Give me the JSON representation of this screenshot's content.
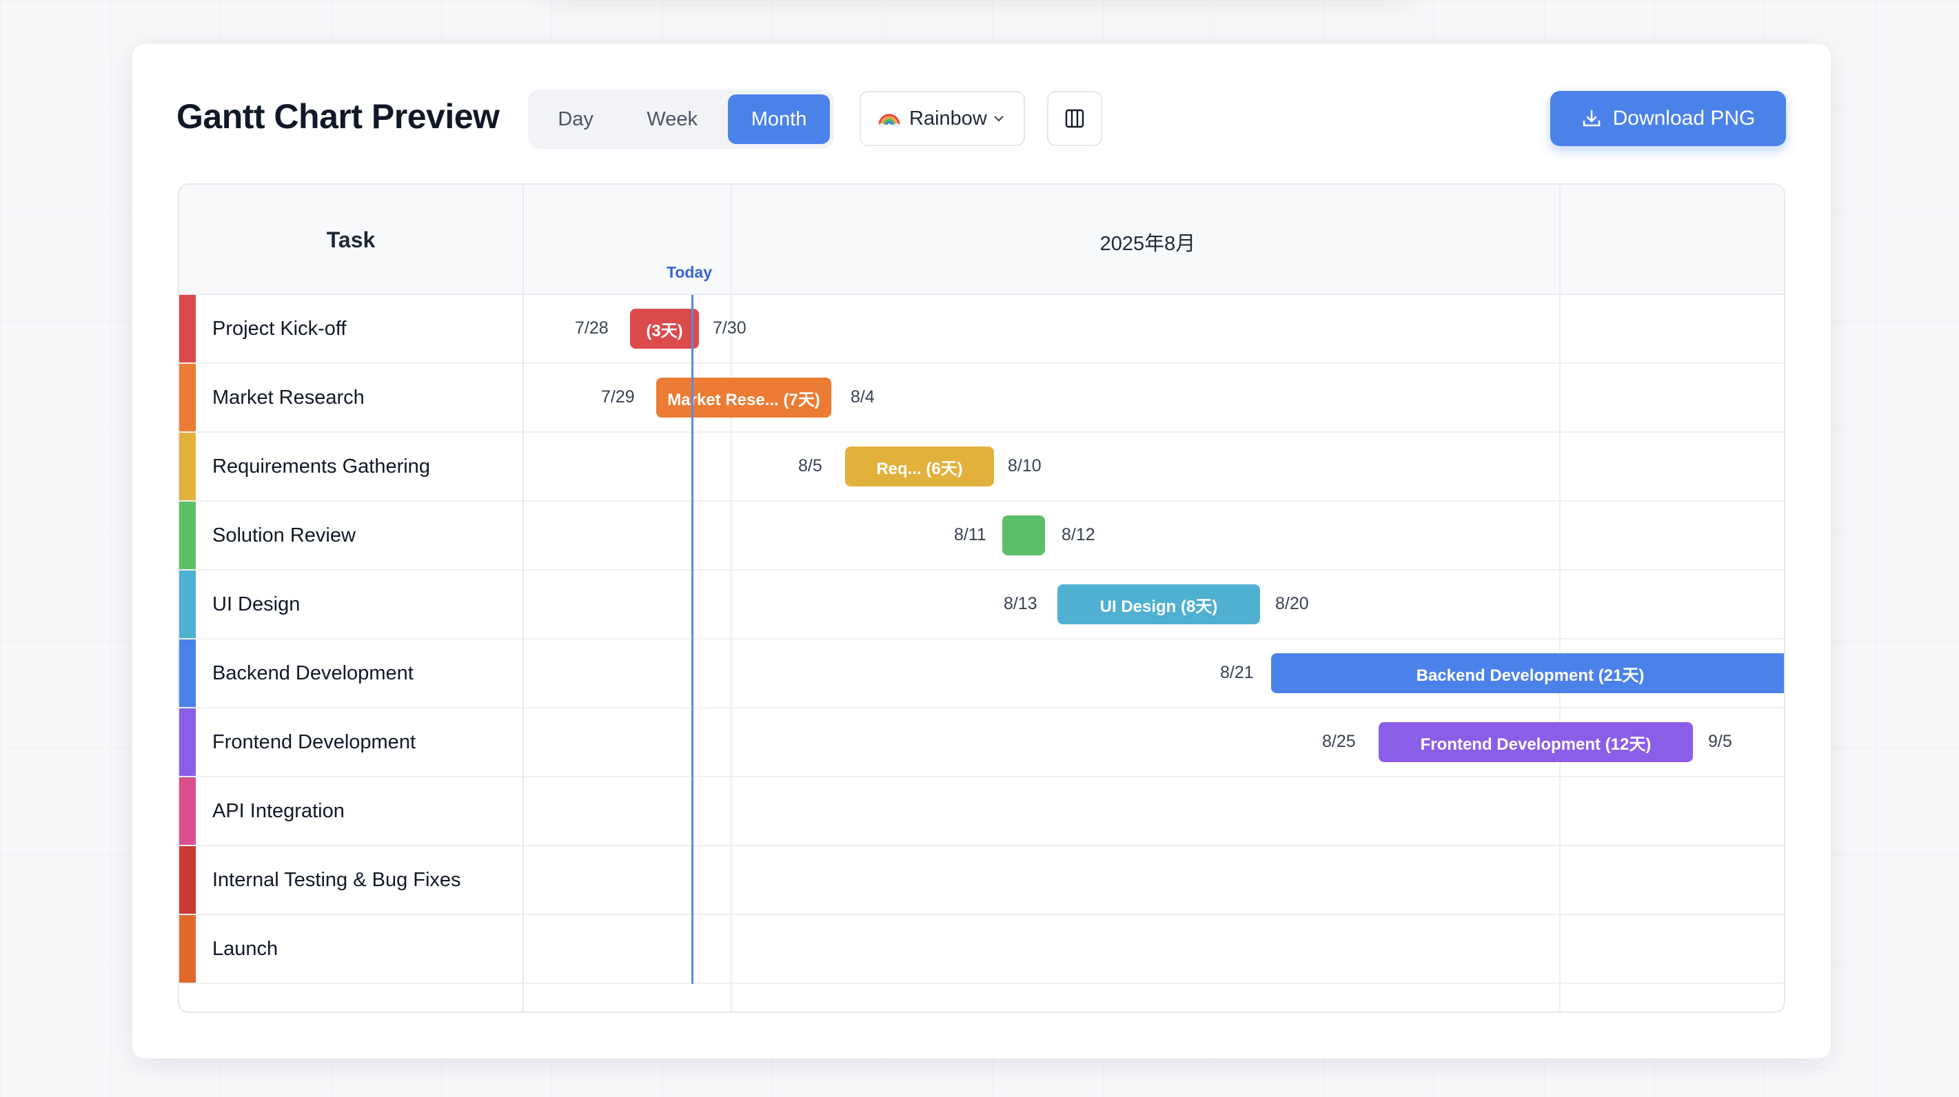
{
  "toolbar": {
    "title": "Gantt Chart Preview",
    "views": [
      {
        "label": "Day",
        "active": false
      },
      {
        "label": "Week",
        "active": false
      },
      {
        "label": "Month",
        "active": true
      }
    ],
    "theme": {
      "label": "Rainbow",
      "icon": "rainbow-icon"
    },
    "columns_icon": "columns-icon",
    "download_label": "Download PNG",
    "accent_color": "#4b82ea"
  },
  "gantt": {
    "task_header": "Task",
    "period_header": "2025年8月",
    "today_label": "Today",
    "tasks": [
      {
        "name": "Project Kick-off",
        "color": "#dc4b4b",
        "start_label": "7/28",
        "end_label": "7/30",
        "bar_text": "(3天)"
      },
      {
        "name": "Market Research",
        "color": "#ec7b34",
        "start_label": "7/29",
        "end_label": "8/4",
        "bar_text": "Market Rese... (7天)"
      },
      {
        "name": "Requirements Gathering",
        "color": "#e2b13c",
        "start_label": "8/5",
        "end_label": "8/10",
        "bar_text": "Req... (6天)"
      },
      {
        "name": "Solution Review",
        "color": "#5cbf67",
        "start_label": "8/11",
        "end_label": "8/12",
        "bar_text": ""
      },
      {
        "name": "UI Design",
        "color": "#4fb0d1",
        "start_label": "8/13",
        "end_label": "8/20",
        "bar_text": "UI Design (8天)"
      },
      {
        "name": "Backend Development",
        "color": "#4b82ea",
        "start_label": "8/21",
        "end_label": "",
        "bar_text": "Backend Development (21天)"
      },
      {
        "name": "Frontend Development",
        "color": "#8b5ee8",
        "start_label": "8/25",
        "end_label": "9/5",
        "bar_text": "Frontend Development (12天)"
      },
      {
        "name": "API Integration",
        "color": "#d9508c",
        "start_label": "",
        "end_label": "",
        "bar_text": ""
      },
      {
        "name": "Internal Testing & Bug Fixes",
        "color": "#c93a33",
        "start_label": "",
        "end_label": "",
        "bar_text": ""
      },
      {
        "name": "Launch",
        "color": "#e06a2d",
        "start_label": "",
        "end_label": "",
        "bar_text": ""
      }
    ]
  }
}
